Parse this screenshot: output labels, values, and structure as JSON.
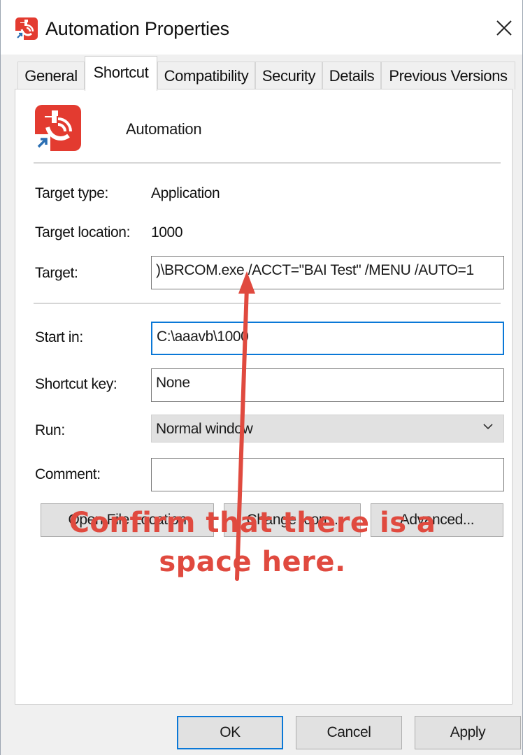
{
  "window": {
    "title": "Automation Properties",
    "close_icon": "close-icon",
    "app_icon": "automation-app-icon"
  },
  "tabs": [
    {
      "label": "General",
      "active": false
    },
    {
      "label": "Shortcut",
      "active": true
    },
    {
      "label": "Compatibility",
      "active": false
    },
    {
      "label": "Security",
      "active": false
    },
    {
      "label": "Details",
      "active": false
    },
    {
      "label": "Previous Versions",
      "active": false
    }
  ],
  "shortcut": {
    "name": "Automation",
    "icon": "automation-shortcut-icon",
    "target_type_label": "Target type:",
    "target_type": "Application",
    "target_location_label": "Target location:",
    "target_location": "1000",
    "target_label": "Target:",
    "target_value": ")\\BRCOM.exe /ACCT=\"BAI Test\" /MENU /AUTO=1",
    "start_in_label": "Start in:",
    "start_in_value": "C:\\aaavb\\1000",
    "shortcut_key_label": "Shortcut key:",
    "shortcut_key_value": "None",
    "run_label": "Run:",
    "run_value": "Normal window",
    "comment_label": "Comment:",
    "comment_value": ""
  },
  "buttons": {
    "open_file_location": "Open File Location",
    "change_icon": "Change Icon...",
    "advanced": "Advanced...",
    "ok": "OK",
    "cancel": "Cancel",
    "apply": "Apply"
  },
  "annotation": {
    "line1": "Confirm that there is a",
    "line2": "space here.",
    "color": "#e04a3f"
  },
  "colors": {
    "accent": "#0a78d7",
    "icon_red": "#e33b30"
  }
}
